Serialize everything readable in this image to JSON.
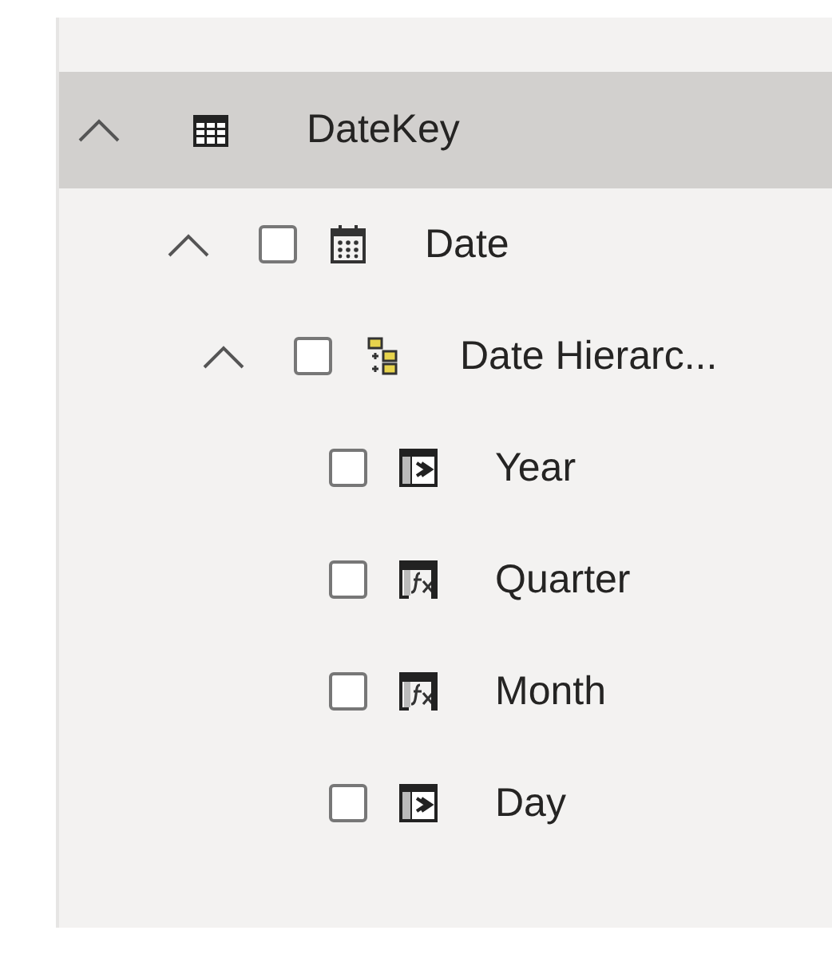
{
  "table": {
    "name": "DateKey",
    "expanded": true,
    "selected": true,
    "children": [
      {
        "kind": "date",
        "label": "Date",
        "expanded": true,
        "checked": false,
        "children": [
          {
            "kind": "hierarchy",
            "label": "Date Hierarc...",
            "expanded": true,
            "checked": false,
            "children": [
              {
                "kind": "level",
                "label": "Year",
                "checked": false
              },
              {
                "kind": "calculated-level",
                "label": "Quarter",
                "checked": false
              },
              {
                "kind": "calculated-level",
                "label": "Month",
                "checked": false
              },
              {
                "kind": "level",
                "label": "Day",
                "checked": false
              }
            ]
          }
        ]
      }
    ]
  }
}
